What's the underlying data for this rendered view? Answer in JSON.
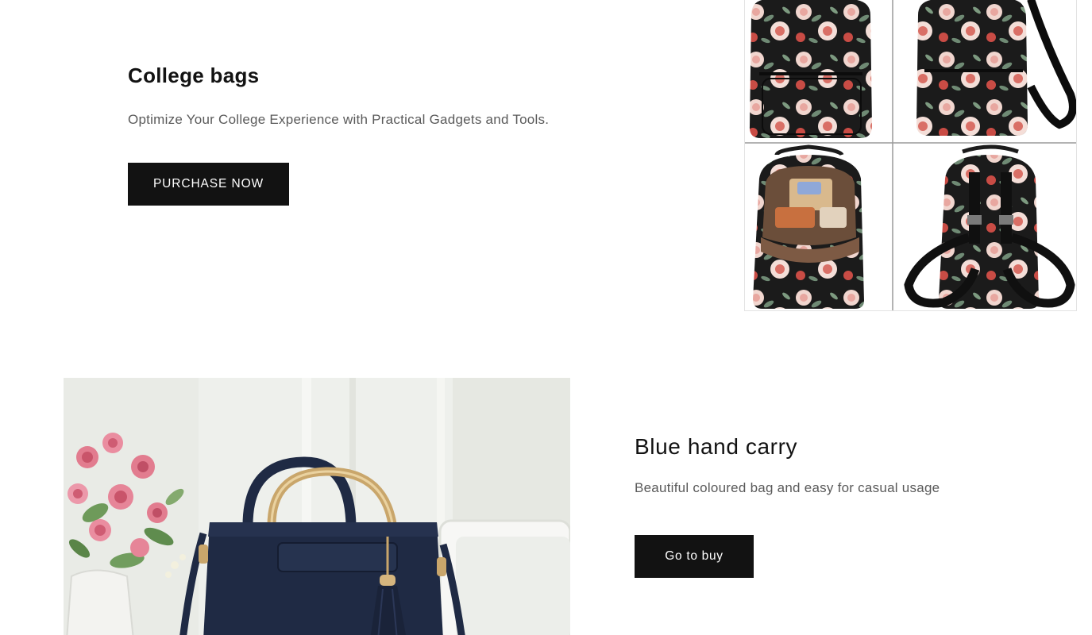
{
  "sections": [
    {
      "title": "College bags",
      "description": "Optimize Your College Experience with Practical Gadgets and Tools.",
      "button_label": "PURCHASE NOW",
      "image_subject": "floral black backpack shown from four angles"
    },
    {
      "title": "Blue hand carry",
      "description": "Beautiful coloured bag and easy for casual usage",
      "button_label": "Go to buy",
      "image_subject": "navy blue handbag with gold handles and tassel beside pink roses"
    }
  ],
  "colors": {
    "button_bg": "#121212",
    "button_text": "#ffffff",
    "heading": "#121212",
    "body_text": "#5a5a5a",
    "backpack_black": "#1b1b1b",
    "rose_pink": "#e8a7a0",
    "navy_bag": "#1f2a44",
    "gold": "#c9a66b"
  }
}
